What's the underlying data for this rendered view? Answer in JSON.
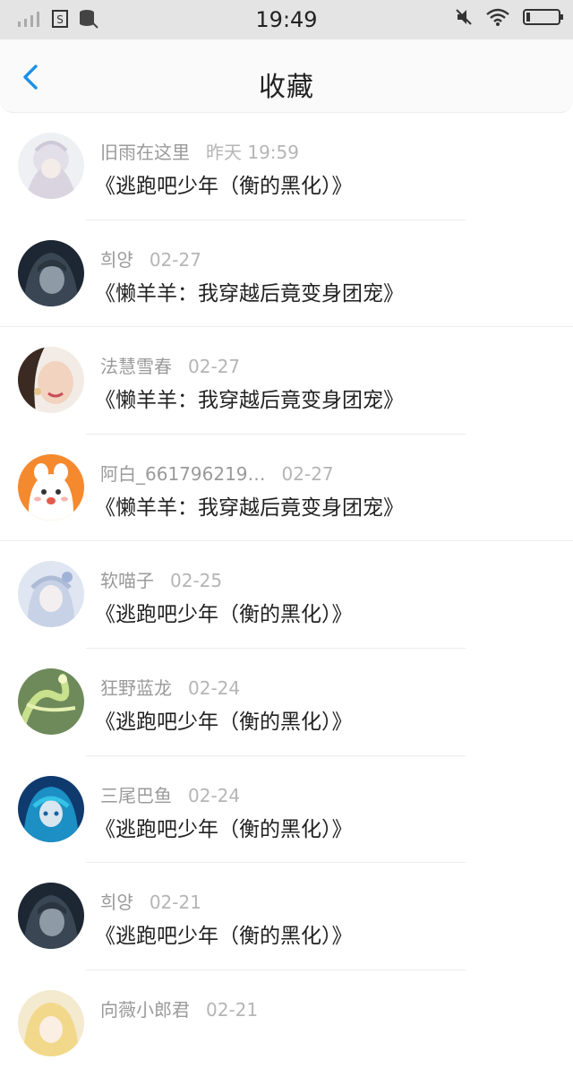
{
  "status_bar": {
    "time": "19:49"
  },
  "header": {
    "title": "收藏"
  },
  "favorites": [
    {
      "user": "旧雨在这里",
      "date": "昨天 19:59",
      "book": "《逃跑吧少年（衡的黑化）》"
    },
    {
      "user": "희양",
      "date": "02-27",
      "book": "《懒羊羊：我穿越后竟变身团宠》"
    },
    {
      "user": "法慧雪春",
      "date": "02-27",
      "book": "《懒羊羊：我穿越后竟变身团宠》"
    },
    {
      "user": "阿白_661796219…",
      "date": "02-27",
      "book": "《懒羊羊：我穿越后竟变身团宠》"
    },
    {
      "user": "软喵子",
      "date": "02-25",
      "book": "《逃跑吧少年（衡的黑化）》"
    },
    {
      "user": "狂野蓝龙",
      "date": "02-24",
      "book": "《逃跑吧少年（衡的黑化）》"
    },
    {
      "user": "三尾巴鱼",
      "date": "02-24",
      "book": "《逃跑吧少年（衡的黑化）》"
    },
    {
      "user": "희양",
      "date": "02-21",
      "book": "《逃跑吧少年（衡的黑化）》"
    },
    {
      "user": "向薇小郎君",
      "date": "02-21",
      "book": ""
    }
  ],
  "colors": {
    "accent": "#1e90e6",
    "status_bar_bg": "#e4e4e4",
    "header_bg": "#fafafa"
  },
  "icons": {
    "back": "chevron-left-icon",
    "signal": "signal-icon",
    "wifi": "wifi-icon",
    "battery": "battery-icon",
    "mute": "mute-icon"
  }
}
